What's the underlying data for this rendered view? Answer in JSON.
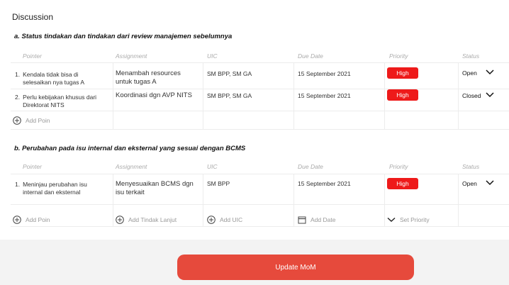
{
  "page": {
    "heading": "Discussion"
  },
  "columns": [
    "Pointer",
    "Assignment",
    "UIC",
    "Due Date",
    "Priority",
    "Status"
  ],
  "section_a": {
    "title": "a. Status tindakan dan tindakan dari review manajemen sebelumnya",
    "rows": [
      {
        "pointer_num": "1.",
        "pointer_l1": "Kendala tidak bisa di",
        "pointer_l2": "selesaikan nya tugas A",
        "assign_l1": "Menambah resources",
        "assign_l2": "untuk tugas A",
        "uic": "SM BPP, SM GA",
        "due": "15 September 2021",
        "priority": "High",
        "status": "Open"
      },
      {
        "pointer_num": "2.",
        "pointer_l1": "Perlu kebijakan khusus dari",
        "pointer_l2": "Direktorat NITS",
        "assign_l1": "Koordinasi dgn AVP NITS",
        "assign_l2": "",
        "uic": "SM BPP, SM GA",
        "due": "15 September 2021",
        "priority": "High",
        "status": "Closed"
      }
    ],
    "add_poin": "Add Poin"
  },
  "section_b": {
    "title": "b. Perubahan pada isu internal dan eksternal yang sesuai dengan BCMS",
    "rows": [
      {
        "pointer_num": "1.",
        "pointer_l1": "Meninjau perubahan isu",
        "pointer_l2": "internal dan eksternal",
        "assign_l1": "Menyesuaikan BCMS dgn",
        "assign_l2": "isu terkait",
        "uic": "SM BPP",
        "due": "15 September 2021",
        "priority": "High",
        "status": "Open"
      }
    ],
    "add_poin": "Add Poin",
    "add_tindak": "Add Tindak Lanjut",
    "add_uic": "Add UIC",
    "add_date": "Add Date",
    "set_priority": "Set Priority"
  },
  "footer": {
    "update_label": "Update MoM"
  },
  "colors": {
    "priority_high": "#ee1a1a",
    "update_button": "#e64a3c"
  },
  "icons": [
    "plus-circle-icon",
    "chevron-down-icon",
    "calendar-icon"
  ]
}
